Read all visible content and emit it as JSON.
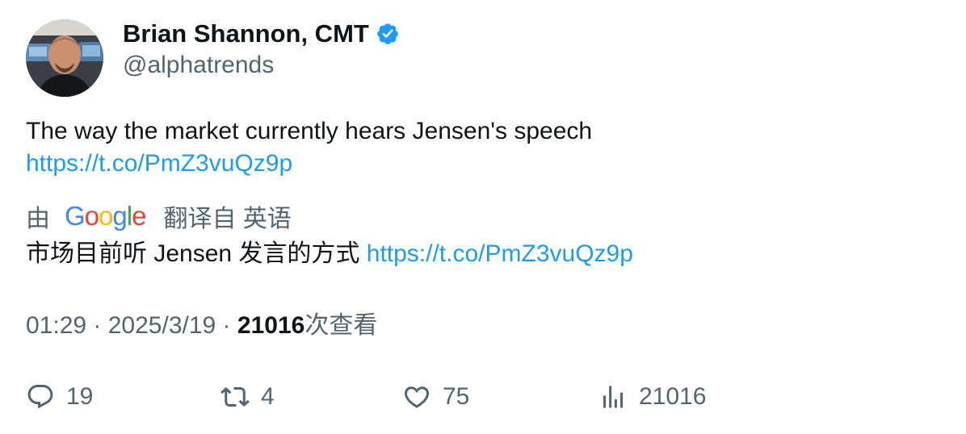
{
  "author": {
    "display_name": "Brian Shannon, CMT",
    "handle": "@alphatrends",
    "verified_icon": "verified-badge-icon"
  },
  "tweet": {
    "text": "The way the market currently hears Jensen's speech",
    "link": "https://t.co/PmZ3vuQz9p"
  },
  "translation": {
    "prefix": "由",
    "provider": "Google",
    "suffix": "翻译自 英语",
    "text": "市场目前听 Jensen 发言的方式",
    "link": "https://t.co/PmZ3vuQz9p"
  },
  "meta": {
    "time": "01:29",
    "separator1": " · ",
    "date": "2025/3/19",
    "separator2": " · ",
    "views_count": "21016",
    "views_label": "次查看"
  },
  "actions": {
    "replies": "19",
    "retweets": "4",
    "likes": "75",
    "views": "21016"
  },
  "colors": {
    "link": "#1d9bf0",
    "secondary_text": "#536471",
    "primary_text": "#0f1419",
    "verified": "#1d9bf0"
  }
}
